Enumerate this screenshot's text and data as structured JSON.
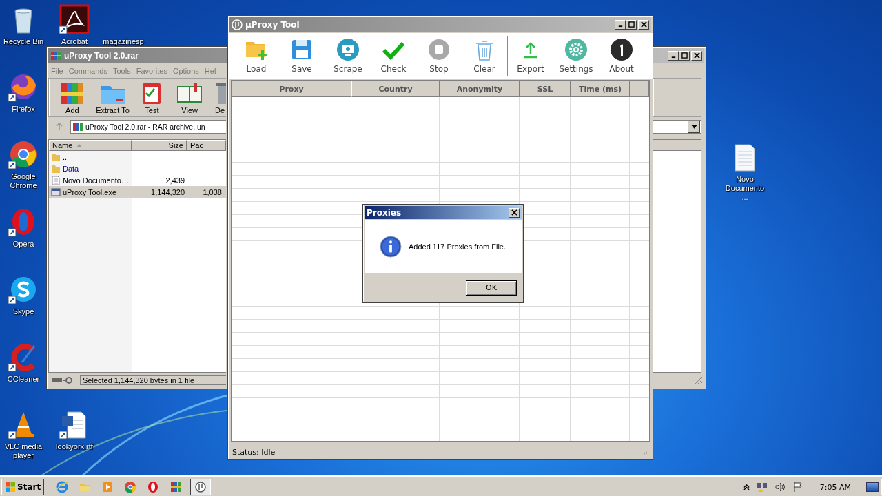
{
  "desktop_icons": [
    {
      "label": "Recycle Bin",
      "kind": "recycle"
    },
    {
      "label": "Firefox",
      "kind": "firefox"
    },
    {
      "label": "Google Chrome",
      "kind": "chrome"
    },
    {
      "label": "Opera",
      "kind": "opera"
    },
    {
      "label": "Skype",
      "kind": "skype"
    },
    {
      "label": "CCleaner",
      "kind": "ccleaner"
    },
    {
      "label": "VLC media player",
      "kind": "vlc"
    },
    {
      "label": "Acrobat",
      "kind": "acrobat"
    },
    {
      "label": "magazinesp",
      "kind": "hidden"
    },
    {
      "label": "lookyork.rtf",
      "kind": "word"
    },
    {
      "label": "Novo Documento ...",
      "kind": "text"
    }
  ],
  "winrar": {
    "title": "uProxy Tool 2.0.rar",
    "menu": [
      "File",
      "Commands",
      "Tools",
      "Favorites",
      "Options",
      "Hel"
    ],
    "toolbar": [
      {
        "label": "Add",
        "kind": "add"
      },
      {
        "label": "Extract To",
        "kind": "extract"
      },
      {
        "label": "Test",
        "kind": "test"
      },
      {
        "label": "View",
        "kind": "view"
      },
      {
        "label": "De",
        "kind": "delete"
      }
    ],
    "path": "uProxy Tool 2.0.rar - RAR archive, un",
    "columns": [
      {
        "label": "Name",
        "sorted": true
      },
      {
        "label": "Size",
        "sorted": false
      },
      {
        "label": "Pac",
        "sorted": false
      }
    ],
    "files": [
      {
        "name": "..",
        "kind": "folder",
        "selected": false
      },
      {
        "name": "Data",
        "kind": "folder",
        "selected": false
      },
      {
        "name": "Novo Documento…",
        "kind": "text",
        "size": "2,439",
        "selected": false
      },
      {
        "name": "uProxy Tool.exe",
        "kind": "exe",
        "size": "1,144,320",
        "packed": "1,038,",
        "selected": true
      }
    ],
    "status": "Selected 1,144,320 bytes in 1 file"
  },
  "uproxy": {
    "title": "µProxy Tool",
    "toolbar_groups": [
      [
        {
          "label": "Load",
          "kind": "load"
        },
        {
          "label": "Save",
          "kind": "save"
        }
      ],
      [
        {
          "label": "Scrape",
          "kind": "scrape"
        },
        {
          "label": "Check",
          "kind": "check"
        },
        {
          "label": "Stop",
          "kind": "stop"
        },
        {
          "label": "Clear",
          "kind": "clear"
        }
      ],
      [
        {
          "label": "Export",
          "kind": "export"
        },
        {
          "label": "Settings",
          "kind": "settings"
        },
        {
          "label": "About",
          "kind": "about"
        }
      ]
    ],
    "columns": [
      "Proxy",
      "Country",
      "Anonymity",
      "SSL",
      "Time (ms)"
    ],
    "status": "Status: Idle"
  },
  "dialog": {
    "title": "Proxies",
    "message": "Added 117 Proxies from File.",
    "button": "OK"
  },
  "taskbar": {
    "start": "Start",
    "apps": [
      {
        "kind": "ie",
        "selected": false
      },
      {
        "kind": "explorer",
        "selected": false
      },
      {
        "kind": "media",
        "selected": false
      },
      {
        "kind": "chrome",
        "selected": false
      },
      {
        "kind": "opera",
        "selected": false
      },
      {
        "kind": "winrar",
        "selected": false
      },
      {
        "kind": "uproxy",
        "selected": true
      }
    ],
    "clock": "7:05 AM"
  }
}
